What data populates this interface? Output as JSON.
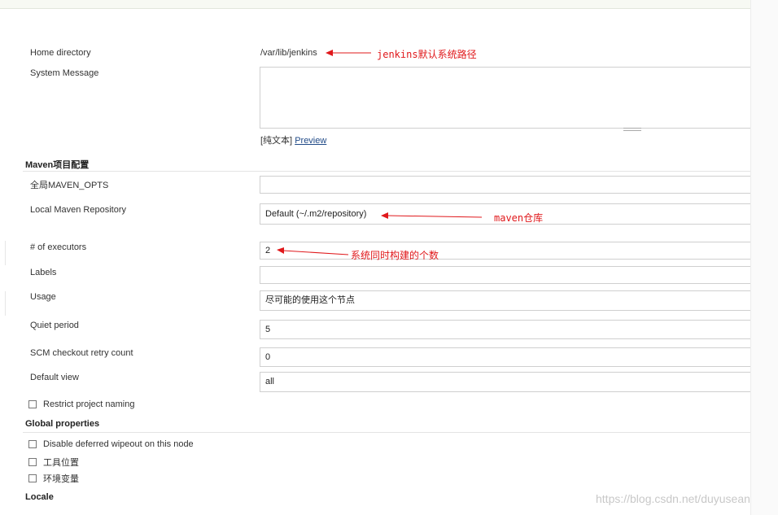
{
  "form": {
    "home_directory": {
      "label": "Home directory",
      "value": "/var/lib/jenkins"
    },
    "system_message": {
      "label": "System Message",
      "value": ""
    },
    "syntax": {
      "prefix": "[纯文本]",
      "preview_link": "Preview"
    }
  },
  "maven_section": {
    "title": "Maven项目配置",
    "maven_opts": {
      "label": "全局MAVEN_OPTS",
      "value": ""
    },
    "local_repo": {
      "label": "Local Maven Repository",
      "value": "Default (~/.m2/repository)"
    }
  },
  "node_settings": {
    "executors": {
      "label": "# of executors",
      "value": "2"
    },
    "labels": {
      "label": "Labels",
      "value": ""
    },
    "usage": {
      "label": "Usage",
      "value": "尽可能的使用这个节点"
    },
    "quiet_period": {
      "label": "Quiet period",
      "value": "5"
    },
    "scm_retry": {
      "label": "SCM checkout retry count",
      "value": "0"
    },
    "default_view": {
      "label": "Default view",
      "value": "all"
    },
    "restrict_naming": {
      "label": "Restrict project naming",
      "checked": false
    }
  },
  "global_properties": {
    "title": "Global properties",
    "disable_wipeout": {
      "label": "Disable deferred wipeout on this node",
      "checked": false
    },
    "tool_locations": {
      "label": "工具位置",
      "checked": false
    },
    "env_vars": {
      "label": "环境变量",
      "checked": false
    }
  },
  "locale": {
    "title": "Locale"
  },
  "annotations": {
    "home": "jenkins默认系统路径",
    "maven": "maven仓库",
    "executors": "系统同时构建的个数",
    "color": "#e0181b"
  },
  "watermark": "https://blog.csdn.net/duyusean"
}
